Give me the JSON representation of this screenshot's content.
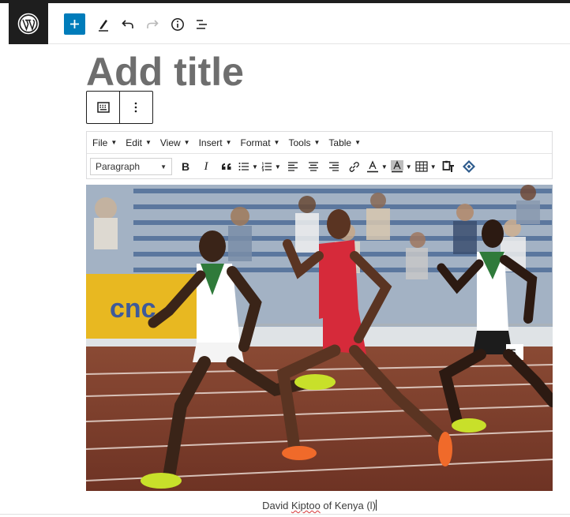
{
  "header": {
    "logo_icon": "wordpress-logo-icon",
    "add_block_icon": "plus-icon",
    "tools_icon": "pencil-icon",
    "undo_icon": "undo-icon",
    "redo_icon": "redo-icon",
    "details_icon": "info-icon",
    "outline_icon": "list-view-icon"
  },
  "post": {
    "title_placeholder": "Add title"
  },
  "block_toolbar": {
    "block_type_icon": "classic-block-icon",
    "options_icon": "more-vertical-icon"
  },
  "classic_editor": {
    "menus": [
      {
        "label": "File"
      },
      {
        "label": "Edit"
      },
      {
        "label": "View"
      },
      {
        "label": "Insert"
      },
      {
        "label": "Format"
      },
      {
        "label": "Tools"
      },
      {
        "label": "Table"
      }
    ],
    "paragraph_select": "Paragraph",
    "bold": "B",
    "italic": "I",
    "blockquote": "66"
  },
  "image": {
    "icon": "photo-runners-image"
  },
  "caption": {
    "prefix": "David ",
    "misspelled": "Kiptoo",
    "suffix": " of Kenya (l)"
  },
  "colors": {
    "accent": "#007cba",
    "header_dark": "#1e1e1e",
    "title_placeholder": "#6e6e6e"
  }
}
